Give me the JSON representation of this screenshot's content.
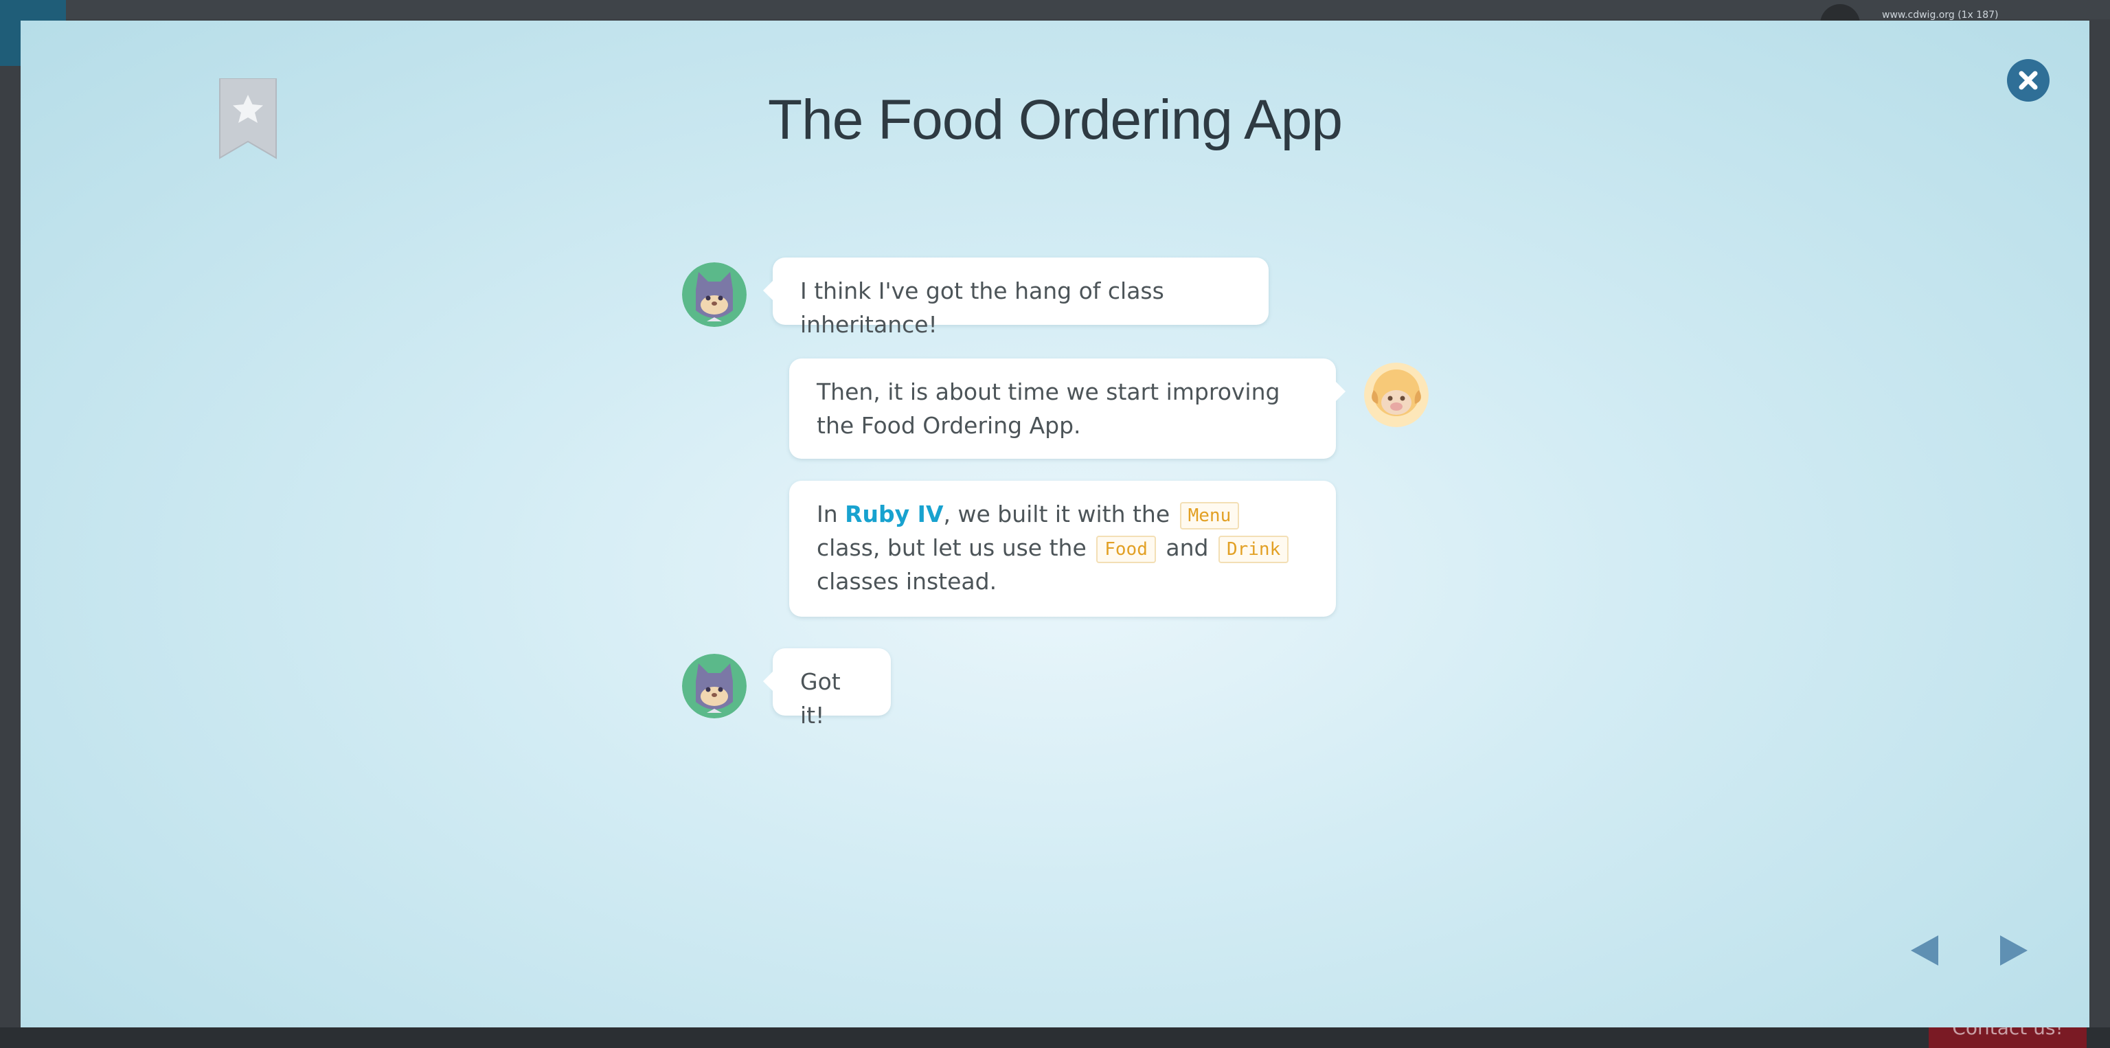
{
  "background": {
    "url_text": "www.cdwig.org (1x 187)",
    "contact_label": "Contact us!"
  },
  "modal": {
    "title": "The Food Ordering App",
    "icons": {
      "bookmark": "bookmark-star-icon",
      "close": "close-icon",
      "prev": "arrow-left-icon",
      "next": "arrow-right-icon"
    },
    "colors": {
      "accent": "#18a2cf",
      "close": "#2f6f97",
      "code": "#e2a024",
      "nav": "#5f90b3"
    }
  },
  "dialogue": [
    {
      "speaker": "cat",
      "text": "I think I've got the hang of class inheritance!"
    },
    {
      "speaker": "sheep",
      "text": "Then, it is about time we start improving the Food Ordering App."
    },
    {
      "speaker": "sheep",
      "parts": {
        "p1": "In ",
        "link": "Ruby IV",
        "p2": ", we built it with the ",
        "code1": "Menu",
        "p3": " class, but let us use the ",
        "code2": "Food",
        "p4": " and ",
        "code3": "Drink",
        "p5": " classes instead."
      }
    },
    {
      "speaker": "cat",
      "text": "Got it!"
    }
  ]
}
